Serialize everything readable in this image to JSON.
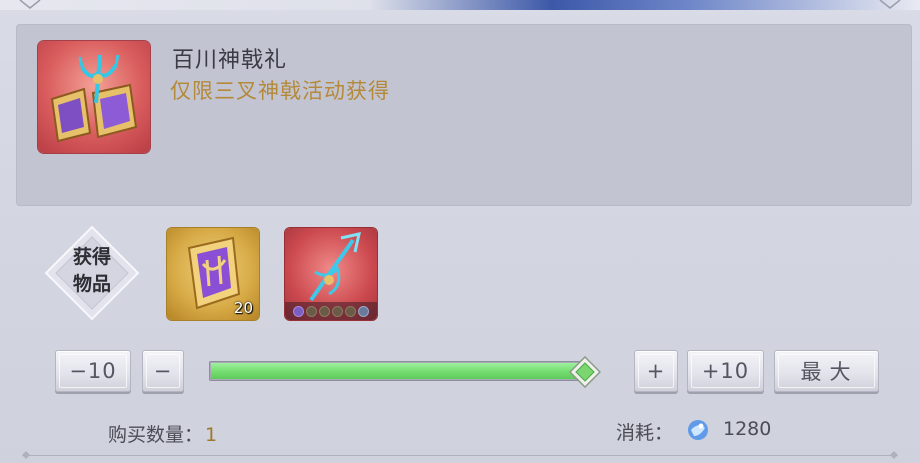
{
  "item": {
    "title": "百川神戟礼",
    "description": "仅限三叉神戟活动获得",
    "icon": "gift-chest-trident-icon"
  },
  "obtain": {
    "label_line1": "获得",
    "label_line2": "物品"
  },
  "rewards": [
    {
      "icon": "purple-trident-emblem-icon",
      "count": "20"
    },
    {
      "icon": "blue-trident-weapon-icon",
      "count": ""
    }
  ],
  "controls": {
    "minus10_label": "−10",
    "minus_label": "−",
    "plus_label": "+",
    "plus10_label": "+10",
    "max_label": "最大"
  },
  "slider": {
    "fraction": 1.0,
    "fill_color": "#76de72"
  },
  "purchase": {
    "quantity_label": "购买数量：",
    "quantity_value": "1",
    "cost_label": "消耗：",
    "cost_icon": "blue-gem-icon",
    "cost_value": "1280"
  },
  "colors": {
    "desc_gold": "#b48a3a",
    "quantity_gold": "#9c7a2a"
  }
}
